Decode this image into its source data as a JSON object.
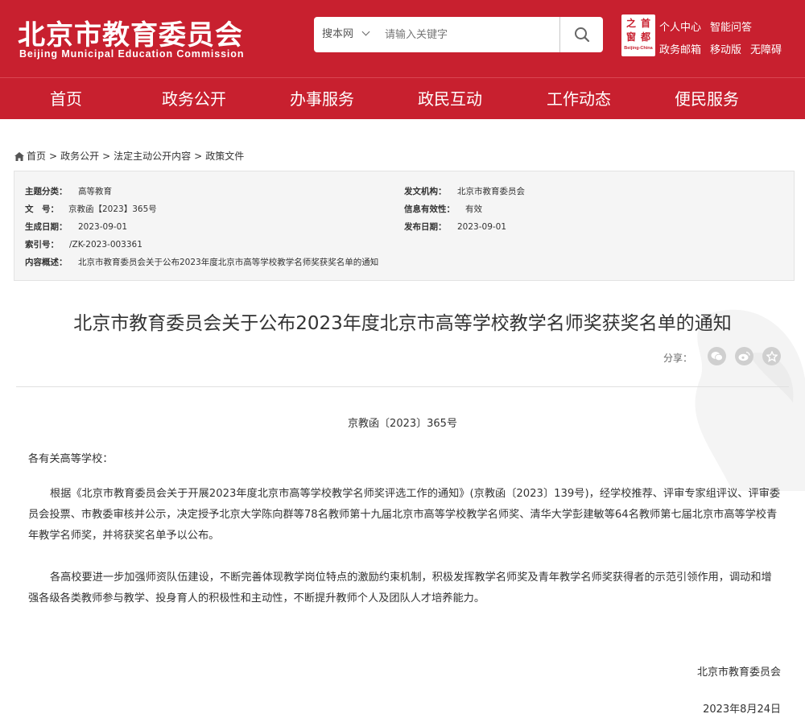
{
  "header": {
    "logo_cn": "北京市教育委员会",
    "logo_en": "Beijing Municipal Education Commission",
    "seal": {
      "chars": [
        "之",
        "首",
        "窗",
        "都"
      ],
      "en": "Beijing-China"
    },
    "links_row1": [
      "个人中心",
      "智能问答"
    ],
    "links_row2": [
      "政务邮箱",
      "移动版",
      "无障碍"
    ],
    "colors": {
      "brand_red": "#c8202f"
    }
  },
  "search": {
    "scope": "搜本网",
    "placeholder": "请输入关键字",
    "value": "",
    "button_icon": "search-icon"
  },
  "nav": {
    "items": [
      "首页",
      "政务公开",
      "办事服务",
      "政民互动",
      "工作动态",
      "便民服务"
    ]
  },
  "breadcrumb": {
    "home_icon": "home-icon",
    "items": [
      "首页",
      "政务公开",
      "法定主动公开内容",
      "政策文件"
    ],
    "separator": ">"
  },
  "meta": {
    "topic": {
      "label": "主题分类：",
      "value": "高等教育"
    },
    "issuer": {
      "label": "发文机构：",
      "value": "北京市教育委员会"
    },
    "docnum": {
      "label": "文　号：",
      "value": "京教函【2023】365号"
    },
    "validity": {
      "label": "信息有效性：",
      "value": "有效"
    },
    "created": {
      "label": "生成日期：",
      "value": "2023-09-01"
    },
    "published": {
      "label": "发布日期：",
      "value": "2023-09-01"
    },
    "index": {
      "label": "索引号：",
      "value": "/ZK-2023-003361"
    },
    "summary": {
      "label": "内容概述：",
      "value": "北京市教育委员会关于公布2023年度北京市高等学校教学名师奖获奖名单的通知"
    }
  },
  "article": {
    "title": "北京市教育委员会关于公布2023年度北京市高等学校教学名师奖获奖名单的通知",
    "share_label": "分享：",
    "share_icons": [
      "wechat-icon",
      "weibo-icon",
      "favorite-icon"
    ],
    "doc_number": "京教函〔2023〕365号",
    "salutation": "各有关高等学校：",
    "paragraph1": "根据《北京市教育委员会关于开展2023年度北京市高等学校教学名师奖评选工作的通知》(京教函〔2023〕139号)，经学校推荐、评审专家组评议、评审委员会投票、市教委审核并公示，决定授予北京大学陈向群等78名教师第十九届北京市高等学校教学名师奖、清华大学彭建敏等64名教师第七届北京市高等学校青年教学名师奖，并将获奖名单予以公布。",
    "paragraph2": "各高校要进一步加强师资队伍建设，不断完善体现教学岗位特点的激励约束机制，积极发挥教学名师奖及青年教学名师奖获得者的示范引领作用，调动和增强各级各类教师参与教学、投身育人的积极性和主动性，不断提升教师个人及团队人才培养能力。",
    "signer": "北京市教育委员会",
    "date": "2023年8月24日"
  }
}
